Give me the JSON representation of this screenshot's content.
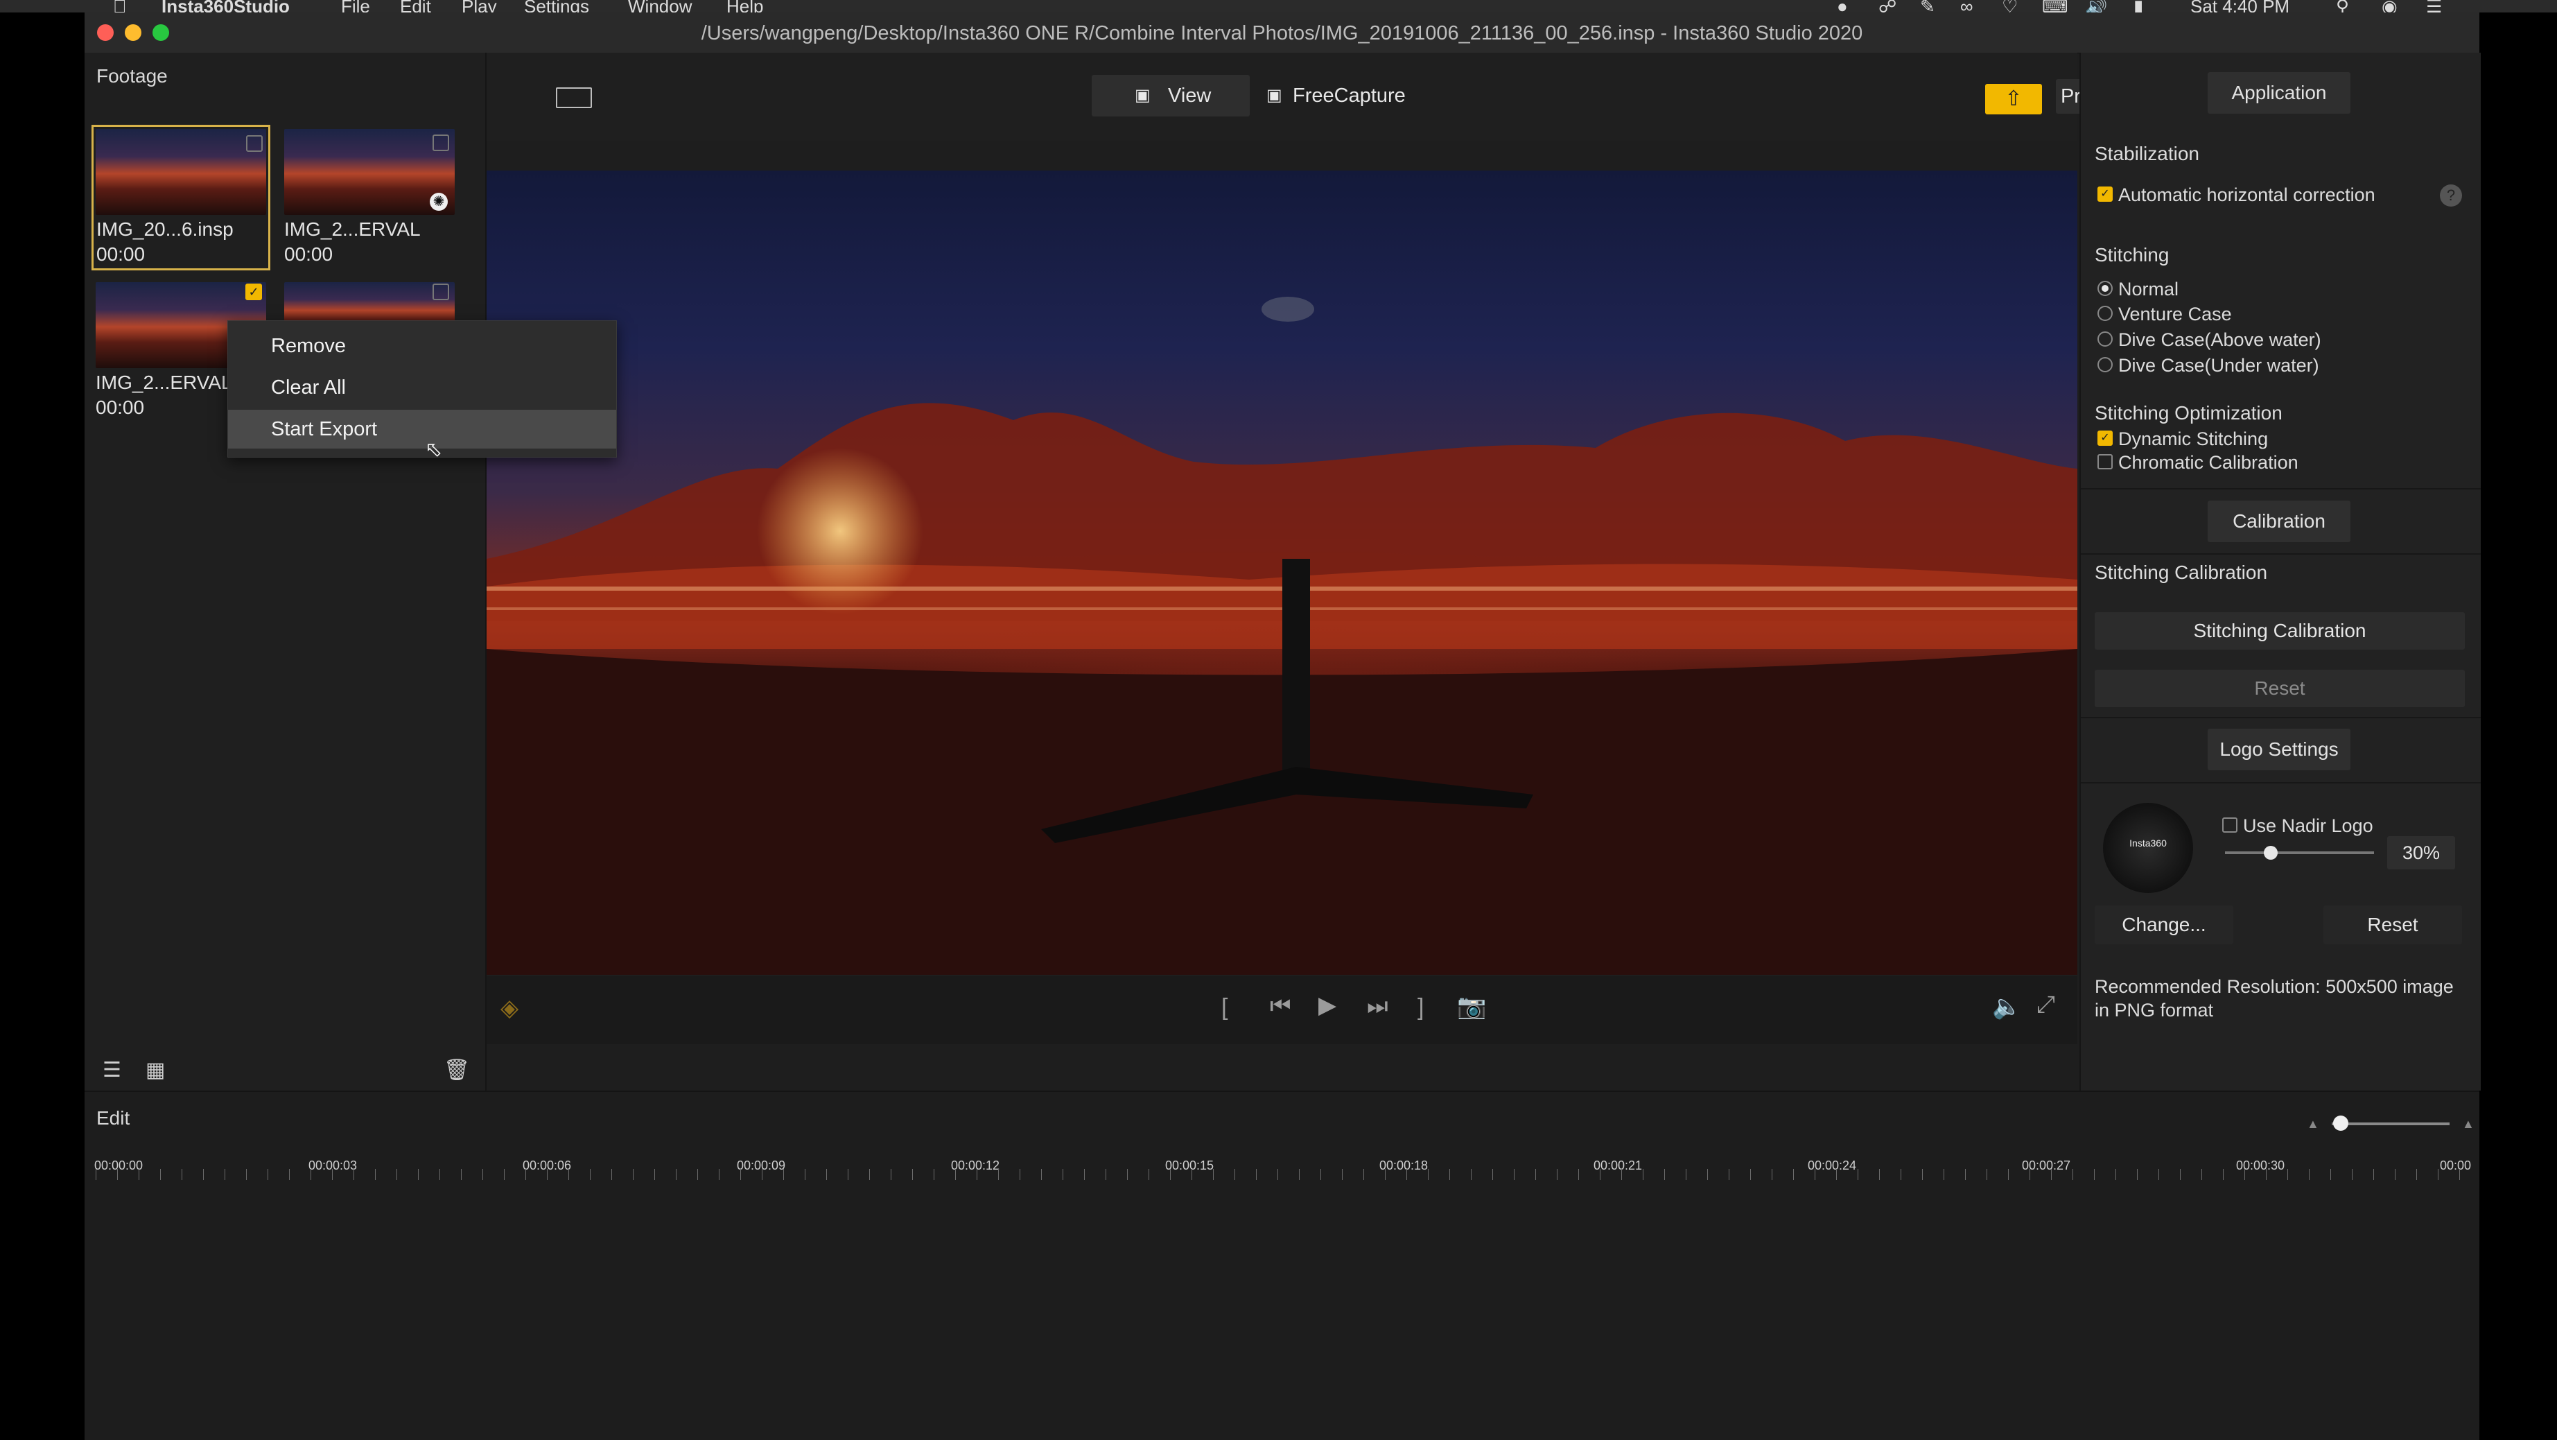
{
  "menubar": {
    "app_name": "Insta360Studio",
    "items": [
      "File",
      "Edit",
      "Play",
      "Settings",
      "Window",
      "Help"
    ],
    "clock": "Sat 4:40 PM"
  },
  "window": {
    "title": "/Users/wangpeng/Desktop/Insta360 ONE R/Combine Interval Photos/IMG_20191006_211136_00_256.insp - Insta360 Studio 2020"
  },
  "footage": {
    "label": "Footage",
    "items": [
      {
        "name": "IMG_20...6.insp",
        "time": "00:00",
        "checked": false,
        "selected": true
      },
      {
        "name": "IMG_2...ERVAL",
        "time": "00:00",
        "checked": false,
        "selected": false
      },
      {
        "name": "IMG_2...ERVAL",
        "time": "00:00",
        "checked": true,
        "selected": false
      },
      {
        "name": "",
        "time": "",
        "checked": false,
        "selected": false
      }
    ]
  },
  "context_menu": {
    "items": [
      "Remove",
      "Clear All",
      "Start Export"
    ],
    "highlighted": "Start Export"
  },
  "toolbar": {
    "view_label": "View",
    "freecapture_label": "FreeCapture",
    "progress_label": "Progress"
  },
  "right_panel": {
    "application_btn": "Application",
    "stabilization_label": "Stabilization",
    "auto_horizontal": "Automatic horizontal correction",
    "help_symbol": "?",
    "stitching_label": "Stitching",
    "stitching_options": [
      "Normal",
      "Venture Case",
      "Dive Case(Above water)",
      "Dive Case(Under water)"
    ],
    "stitching_selected": "Normal",
    "stitching_opt_label": "Stitching Optimization",
    "dynamic_stitching": "Dynamic Stitching",
    "chromatic_calibration": "Chromatic Calibration",
    "calibration_btn": "Calibration",
    "stitching_calibration_label": "Stitching Calibration",
    "stitching_calibration_btn": "Stitching Calibration",
    "reset_btn": "Reset",
    "logo_settings_btn": "Logo Settings",
    "use_nadir_logo": "Use Nadir Logo",
    "logo_text": "Insta360",
    "logo_percent": "30%",
    "logo_percent_value": 30,
    "change_btn": "Change...",
    "reset_logo_btn": "Reset",
    "recommended": "Recommended Resolution: 500x500 image in PNG format"
  },
  "edit": {
    "label": "Edit",
    "ticks": [
      "00:00:00",
      "00:00:03",
      "00:00:06",
      "00:00:09",
      "00:00:12",
      "00:00:15",
      "00:00:18",
      "00:00:21",
      "00:00:24",
      "00:00:27",
      "00:00:30",
      "00:00"
    ]
  },
  "colors": {
    "accent": "#f2b800",
    "selection": "#d7b24a"
  }
}
